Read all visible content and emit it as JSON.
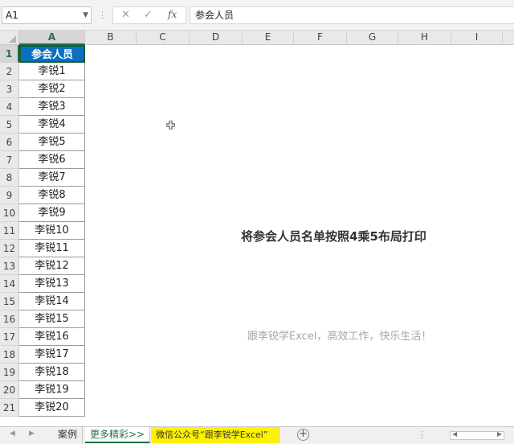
{
  "formula_bar": {
    "name_box": "A1",
    "cancel_glyph": "✕",
    "enter_glyph": "✓",
    "fx_label": "fx",
    "content": "参会人员"
  },
  "columns": [
    "A",
    "B",
    "C",
    "D",
    "E",
    "F",
    "G",
    "H",
    "I"
  ],
  "rows": [
    "1",
    "2",
    "3",
    "4",
    "5",
    "6",
    "7",
    "8",
    "9",
    "10",
    "11",
    "12",
    "13",
    "14",
    "15",
    "16",
    "17",
    "18",
    "19",
    "20",
    "21"
  ],
  "cells_a": [
    "参会人员",
    "李锐1",
    "李锐2",
    "李锐3",
    "李锐4",
    "李锐5",
    "李锐6",
    "李锐7",
    "李锐8",
    "李锐9",
    "李锐10",
    "李锐11",
    "李锐12",
    "李锐13",
    "李锐14",
    "李锐15",
    "李锐16",
    "李锐17",
    "李锐18",
    "李锐19",
    "李锐20"
  ],
  "message_title": "将参会人员名单按照4乘5布局打印",
  "message_sub": "跟李锐学Excel，高效工作，快乐生活！",
  "sheet_tabs": {
    "tab1": "案例",
    "tab2": "更多精彩>>",
    "tab3": "微信公众号“跟李锐学Excel”",
    "add": "+"
  },
  "colors": {
    "header_fill": "#0b6fc2",
    "accent": "#217346",
    "tab_highlight": "#fff200"
  }
}
